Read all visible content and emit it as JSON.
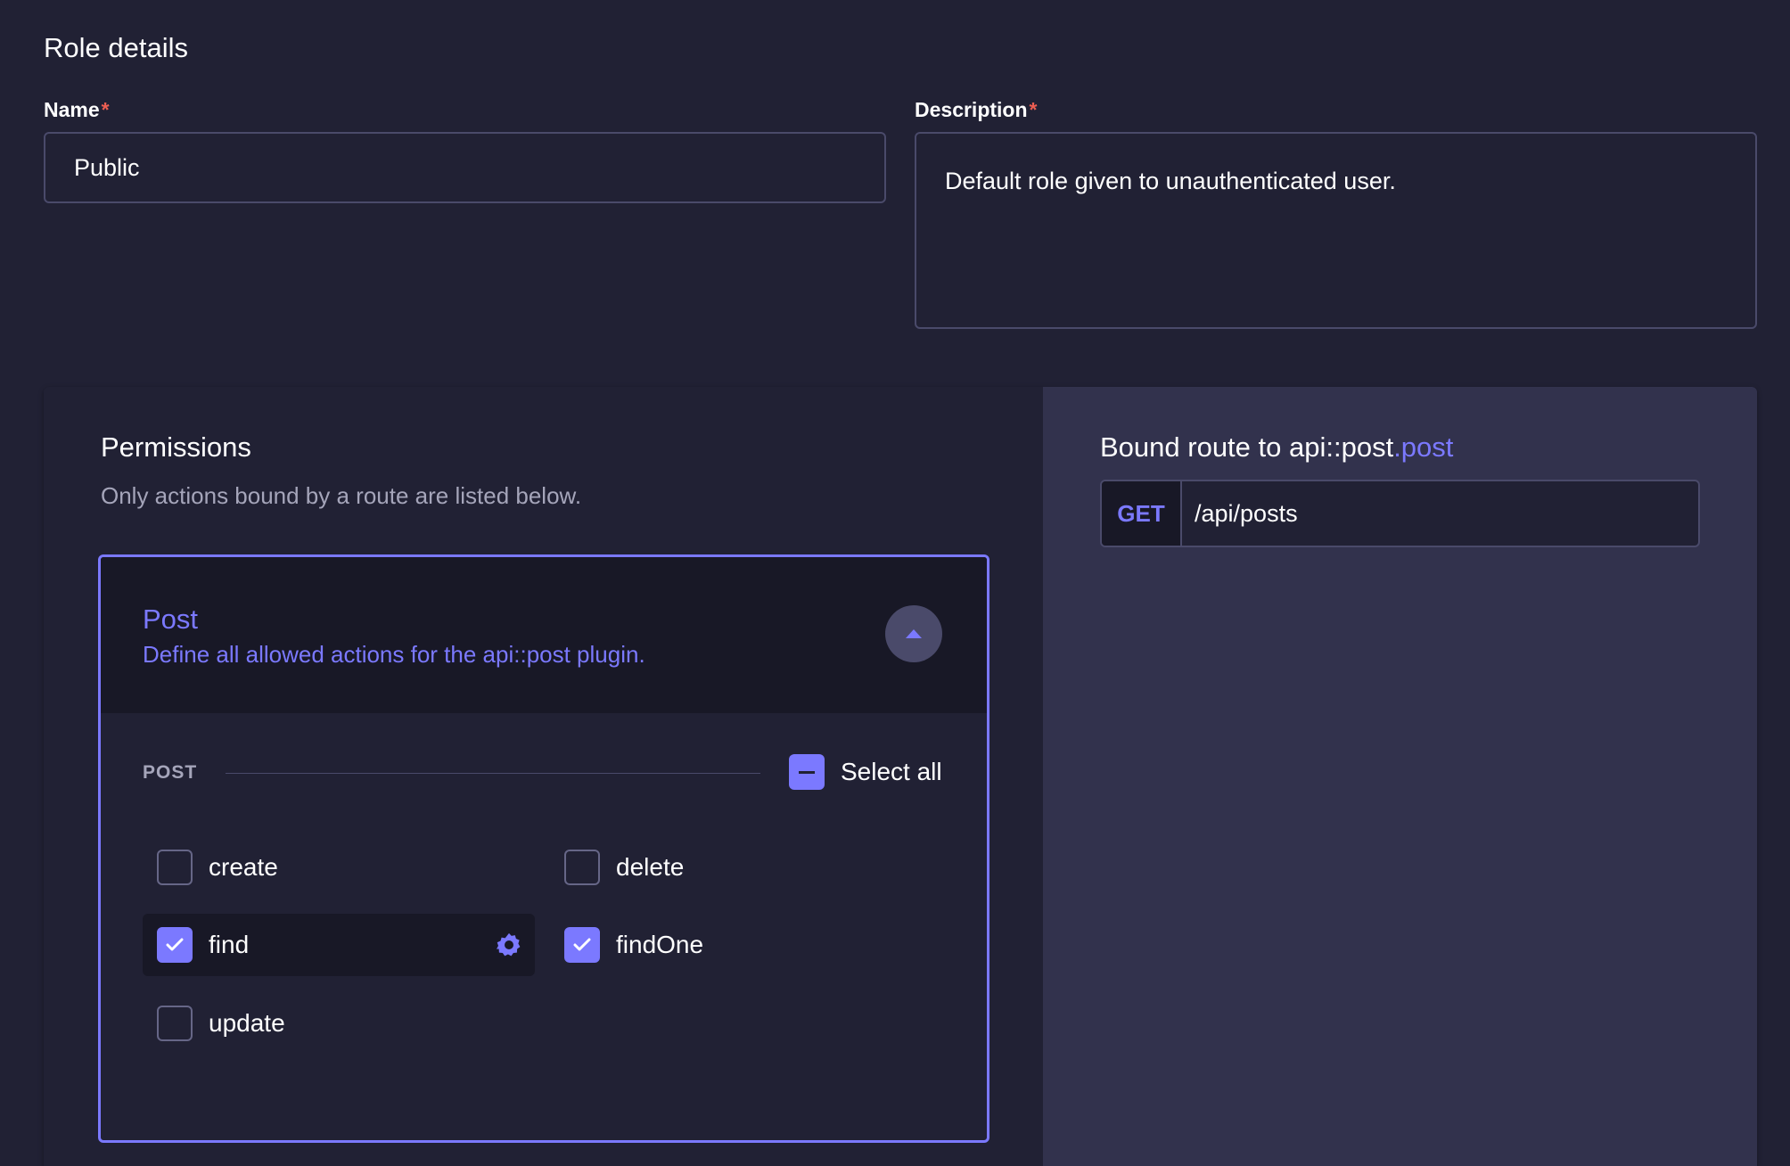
{
  "role_details": {
    "title": "Role details",
    "name": {
      "label": "Name",
      "required_mark": "*",
      "value": "Public"
    },
    "description": {
      "label": "Description",
      "required_mark": "*",
      "value": "Default role given to unauthenticated user."
    }
  },
  "permissions": {
    "title": "Permissions",
    "subtitle": "Only actions bound by a route are listed below.",
    "accordion": {
      "title": "Post",
      "description": "Define all allowed actions for the api::post plugin.",
      "expanded": true,
      "section_label": "POST",
      "select_all_label": "Select all",
      "select_all_state": "indeterminate",
      "actions": [
        {
          "label": "create",
          "checked": false
        },
        {
          "label": "delete",
          "checked": false
        },
        {
          "label": "find",
          "checked": true,
          "active": true
        },
        {
          "label": "findOne",
          "checked": true
        },
        {
          "label": "update",
          "checked": false
        }
      ]
    }
  },
  "bound_route": {
    "title_prefix": "Bound route to api::post",
    "title_accent": ".post",
    "method": "GET",
    "path": "/api/posts"
  },
  "colors": {
    "background": "#212134",
    "accent": "#7b79ff",
    "required": "#ee5e52",
    "side_panel": "#32324d"
  }
}
